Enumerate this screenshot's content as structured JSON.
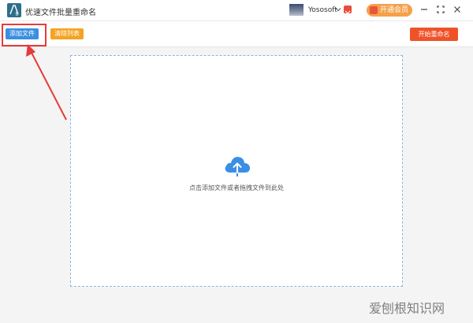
{
  "window": {
    "title": "优速文件批量重命名",
    "username": "Yososoft",
    "vip_label": "开通会员"
  },
  "toolbar": {
    "add_files_label": "添加文件",
    "clear_list_label": "清除列表",
    "start_rename_label": "开始重命名"
  },
  "dropzone": {
    "hint": "点击添加文件或者拖拽文件到此处"
  },
  "watermark": {
    "text": "爱刨根知识网"
  },
  "icons": {
    "logo": "app-logo-icon",
    "upload": "cloud-upload-icon",
    "dropdown": "chevron-down-icon",
    "brand": "brand-badge-icon",
    "minimize": "minimize-icon",
    "maximize": "maximize-icon",
    "close": "close-icon"
  },
  "colors": {
    "primary": "#3b8fe0",
    "clear": "#f5a323",
    "start": "#f05228",
    "vip": "#f5a04a",
    "annotation": "#e53b3b"
  }
}
